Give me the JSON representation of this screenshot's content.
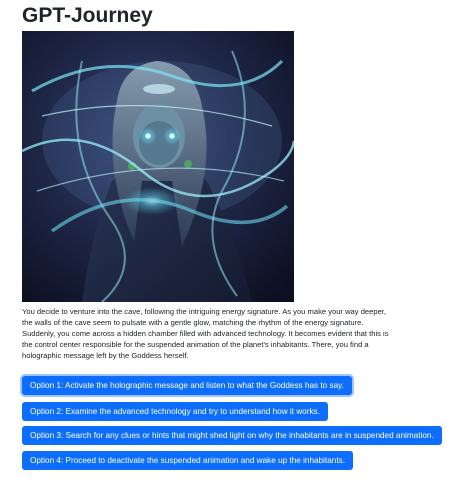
{
  "page": {
    "title": "GPT-Journey"
  },
  "story": {
    "text": "You decide to venture into the cave, following the intriguing energy signature. As you make your way deeper, the walls of the cave seem to pulsate with a gentle glow, matching the rhythm of the energy signature. Suddenly, you come across a hidden chamber filled with advanced technology. It becomes evident that this is the control center responsible for the suspended animation of the planet's inhabitants. There, you find a holographic message left by the Goddess herself."
  },
  "options": [
    {
      "label": "Option 1: Activate the holographic message and listen to what the Goddess has to say."
    },
    {
      "label": "Option 2: Examine the advanced technology and try to understand how it works."
    },
    {
      "label": "Option 3: Search for any clues or hints that might shed light on why the inhabitants are in suspended animation."
    },
    {
      "label": "Option 4: Proceed to deactivate the suspended animation and wake up the inhabitants."
    }
  ],
  "colors": {
    "button": "#0d6efd",
    "button_text": "#ffffff",
    "text": "#212529"
  }
}
